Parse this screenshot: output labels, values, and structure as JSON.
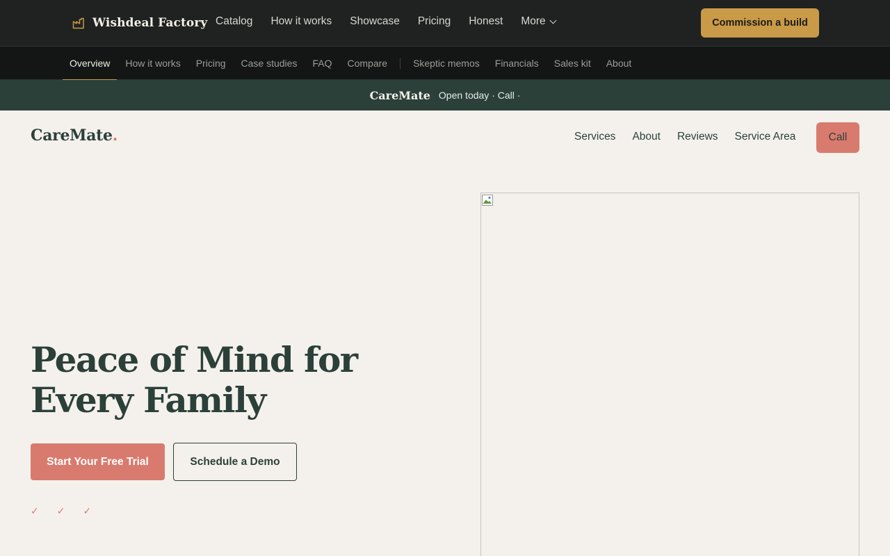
{
  "topbar": {
    "brand": "Wishdeal Factory",
    "nav": [
      "Catalog",
      "How it works",
      "Showcase",
      "Pricing",
      "Honest",
      "More"
    ],
    "cta": "Commission a build",
    "accent": "#c99a48"
  },
  "subnav": {
    "tabs": [
      "Overview",
      "How it works",
      "Pricing",
      "Case studies",
      "FAQ",
      "Compare"
    ],
    "extra": [
      "Skeptic memos",
      "Financials",
      "Sales kit",
      "About"
    ],
    "active": "Overview"
  },
  "announce": {
    "brand": "CareMate",
    "text": "Open today · Call ·"
  },
  "site": {
    "logo": "CareMate",
    "logo_dot": ".",
    "nav": [
      "Services",
      "About",
      "Reviews",
      "Service Area"
    ],
    "call": "Call",
    "brand_color": "#2c403a",
    "accent": "#d97a6e"
  },
  "hero": {
    "title": "Peace of Mind for Every Family",
    "primary_cta": "Start Your Free Trial",
    "secondary_cta": "Schedule a Demo",
    "checks": [
      "✓",
      "✓",
      "✓"
    ],
    "image_icon": "broken-image-icon"
  }
}
